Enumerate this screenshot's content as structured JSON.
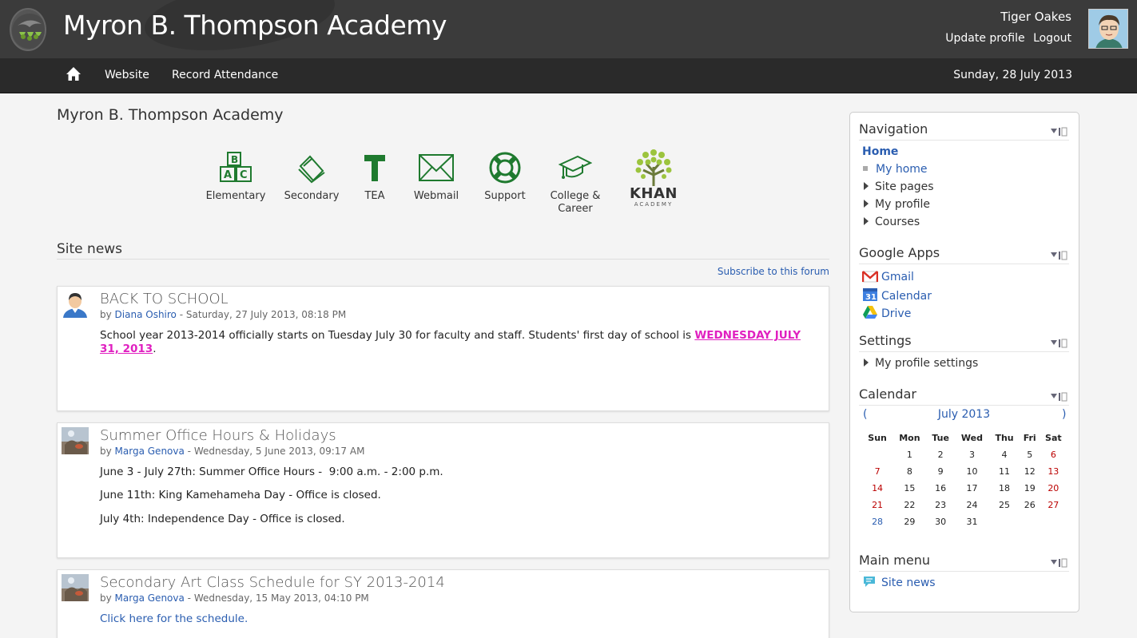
{
  "header": {
    "site_title": "Myron B. Thompson Academy",
    "user_name": "Tiger Oakes",
    "update_profile": "Update profile",
    "logout": "Logout"
  },
  "navbar": {
    "home_icon": "home-icon",
    "items": [
      "Website",
      "Record Attendance"
    ],
    "date": "Sunday, 28 July 2013"
  },
  "main": {
    "heading": "Myron B. Thompson Academy",
    "apps": [
      {
        "label": "Elementary",
        "icon": "abc-blocks-icon"
      },
      {
        "label": "Secondary",
        "icon": "books-icon"
      },
      {
        "label": "TEA",
        "icon": "tea-t-icon"
      },
      {
        "label": "Webmail",
        "icon": "envelope-icon"
      },
      {
        "label": "Support",
        "icon": "lifebuoy-icon"
      },
      {
        "label": "College &",
        "label2": "Career",
        "icon": "graduation-cap-icon"
      },
      {
        "label": "KHAN",
        "label2": "ACADEMY",
        "icon": "khan-tree-icon"
      }
    ],
    "site_news": {
      "title": "Site news",
      "subscribe": "Subscribe to this forum",
      "posts": [
        {
          "subject": "BACK TO SCHOOL",
          "by": "by",
          "author": "Diana Oshiro",
          "date": " - Saturday, 27 July 2013, 08:18 PM",
          "body_prefix": "School year 2013-2014 officially starts on Tuesday July 30 for faculty and staff. Students' first day of school is ",
          "body_highlight": "WEDNESDAY JULY 31, 2013",
          "body_suffix": "."
        },
        {
          "subject": "Summer Office Hours & Holidays",
          "by": "by",
          "author": "Marga Genova",
          "date": " - Wednesday, 5 June 2013, 09:17 AM",
          "lines": [
            "June 3 - July 27th: Summer Office Hours -  9:00 a.m. - 2:00 p.m.",
            "June 11th: King Kamehameha Day - Office is closed.",
            "July 4th: Independence Day - Office is closed."
          ]
        },
        {
          "subject": "Secondary Art Class Schedule for SY 2013-2014",
          "by": "by",
          "author": "Marga Genova",
          "date": " - Wednesday, 15 May 2013, 04:10 PM",
          "link": "Click here for the schedule."
        }
      ]
    }
  },
  "sidebar": {
    "navigation": {
      "title": "Navigation",
      "home": "Home",
      "my_home": "My home",
      "site_pages": "Site pages",
      "my_profile": "My profile",
      "courses": "Courses"
    },
    "google_apps": {
      "title": "Google Apps",
      "items": [
        "Gmail",
        "Calendar",
        "Drive"
      ],
      "calendar_icon_num": "31"
    },
    "settings": {
      "title": "Settings",
      "my_profile_settings": "My profile settings"
    },
    "calendar": {
      "title": "Calendar",
      "month": "July 2013",
      "prev": "(",
      "next": ")",
      "weekdays": [
        "Sun",
        "Mon",
        "Tue",
        "Wed",
        "Thu",
        "Fri",
        "Sat"
      ],
      "weeks": [
        [
          "",
          "1",
          "2",
          "3",
          "4",
          "5",
          "6"
        ],
        [
          "7",
          "8",
          "9",
          "10",
          "11",
          "12",
          "13"
        ],
        [
          "14",
          "15",
          "16",
          "17",
          "18",
          "19",
          "20"
        ],
        [
          "21",
          "22",
          "23",
          "24",
          "25",
          "26",
          "27"
        ],
        [
          "28",
          "29",
          "30",
          "31",
          "",
          "",
          ""
        ]
      ],
      "today": "28",
      "weekend_color": "#b00000",
      "today_color": "#2a5db0"
    },
    "main_menu": {
      "title": "Main menu",
      "site_news": "Site news"
    }
  },
  "colors": {
    "header_bg": "#3b3b3b",
    "navbar_bg": "#2a2a2a",
    "link": "#2a5db0",
    "highlight": "#e020c0",
    "app_icon_green": "#1f7a2f"
  }
}
